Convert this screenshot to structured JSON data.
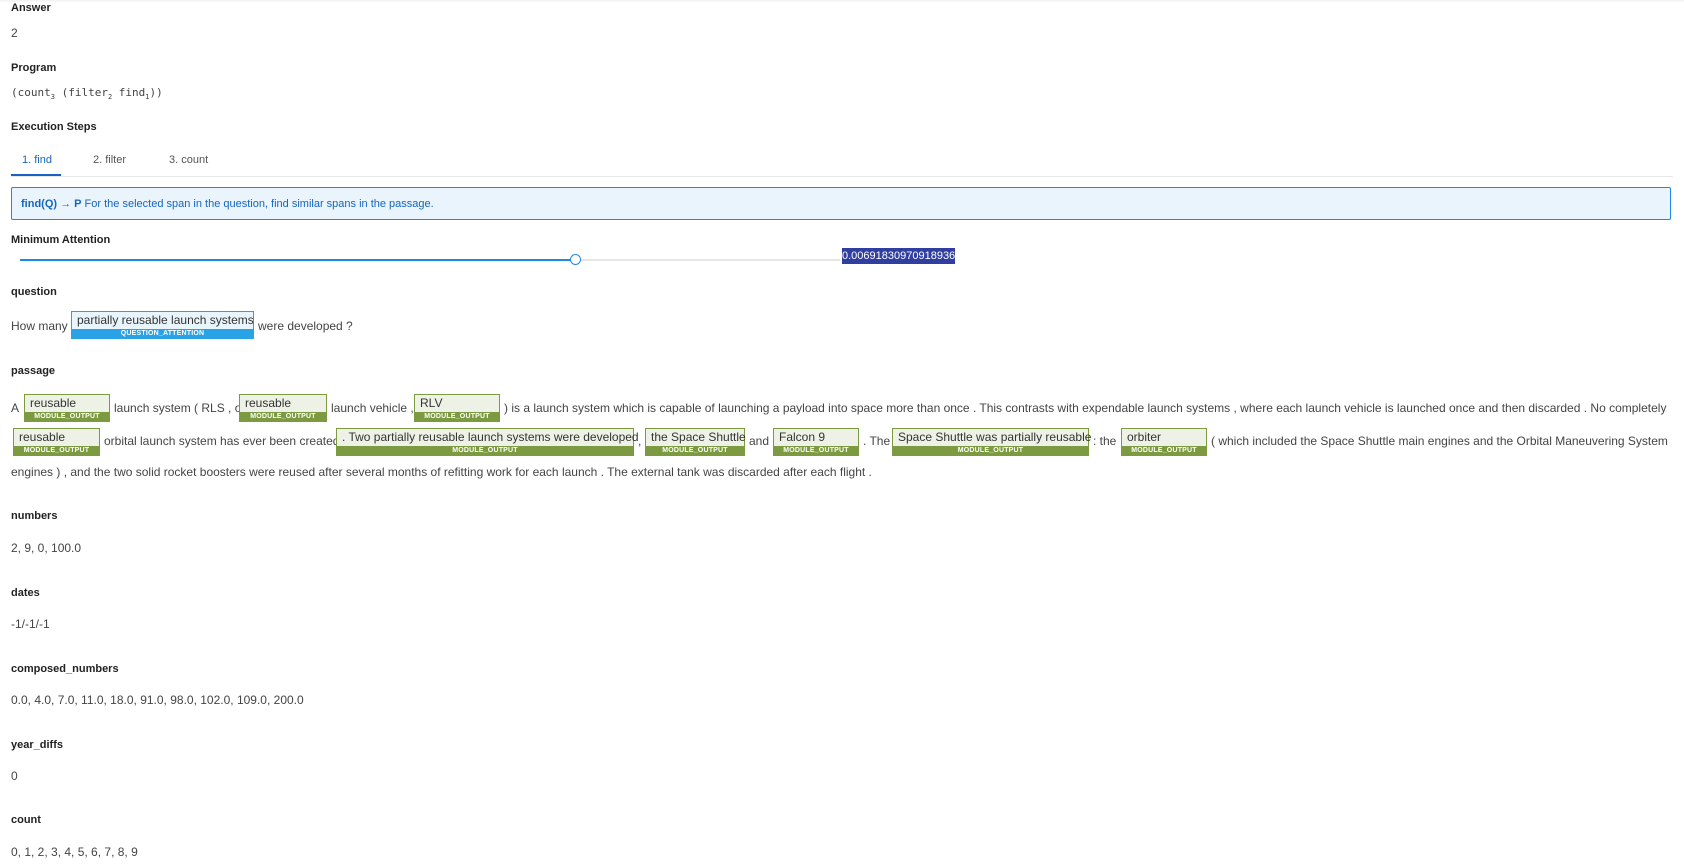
{
  "answer": {
    "label": "Answer",
    "value": "2"
  },
  "program": {
    "label": "Program",
    "value_parts": [
      "(count",
      "3",
      " (filter",
      "2",
      " find",
      "1",
      "))"
    ]
  },
  "execution": {
    "label": "Execution Steps",
    "tabs": [
      "1. find",
      "2. filter",
      "3. count"
    ],
    "info_bold": "find(Q) → P",
    "info_text": " For the selected span in the question, find similar spans in the passage."
  },
  "min_attention": {
    "label": "Minimum Attention",
    "value": "0.00691830970918936",
    "slider_fraction": 0.677
  },
  "question": {
    "label": "question",
    "pre": "How many",
    "chip": "partially reusable launch systems",
    "chip_tag": "QUESTION_ATTENTION",
    "post": "were developed ?"
  },
  "passage": {
    "label": "passage",
    "tag": "MODULE_OUTPUT",
    "line1": {
      "t0": "A",
      "c0": "reusable",
      "t1": "launch system ( RLS , or",
      "c1": "reusable",
      "t2": "launch vehicle ,",
      "c2": "RLV",
      "t3": ") is a launch system which is capable of launching a payload into space more than once . This contrasts with expendable launch systems , where each launch vehicle is launched once and then discarded . No completely"
    },
    "line2": {
      "c0": "reusable",
      "t0": "orbital launch system has ever been created",
      "c1": ". Two partially reusable launch systems were developed",
      "t1": ",",
      "c2": "the Space Shuttle",
      "t2": "and",
      "c3": "Falcon 9",
      "t3": ". The",
      "c4": "Space Shuttle was partially reusable",
      "t4": ": the",
      "c5": "orbiter",
      "t5": "( which included the Space Shuttle main engines and the Orbital Maneuvering System"
    },
    "line3": "engines ) , and the two solid rocket boosters were reused after several months of refitting work for each launch . The external tank was discarded after each flight ."
  },
  "numbers": {
    "label": "numbers",
    "value": "2, 9, 0, 100.0"
  },
  "dates": {
    "label": "dates",
    "value": "-1/-1/-1"
  },
  "composed_numbers": {
    "label": "composed_numbers",
    "value": "0.0, 4.0, 7.0, 11.0, 18.0, 91.0, 98.0, 102.0, 109.0, 200.0"
  },
  "year_diffs": {
    "label": "year_diffs",
    "value": "0"
  },
  "count": {
    "label": "count",
    "value": "0, 1, 2, 3, 4, 5, 6, 7, 8, 9"
  }
}
